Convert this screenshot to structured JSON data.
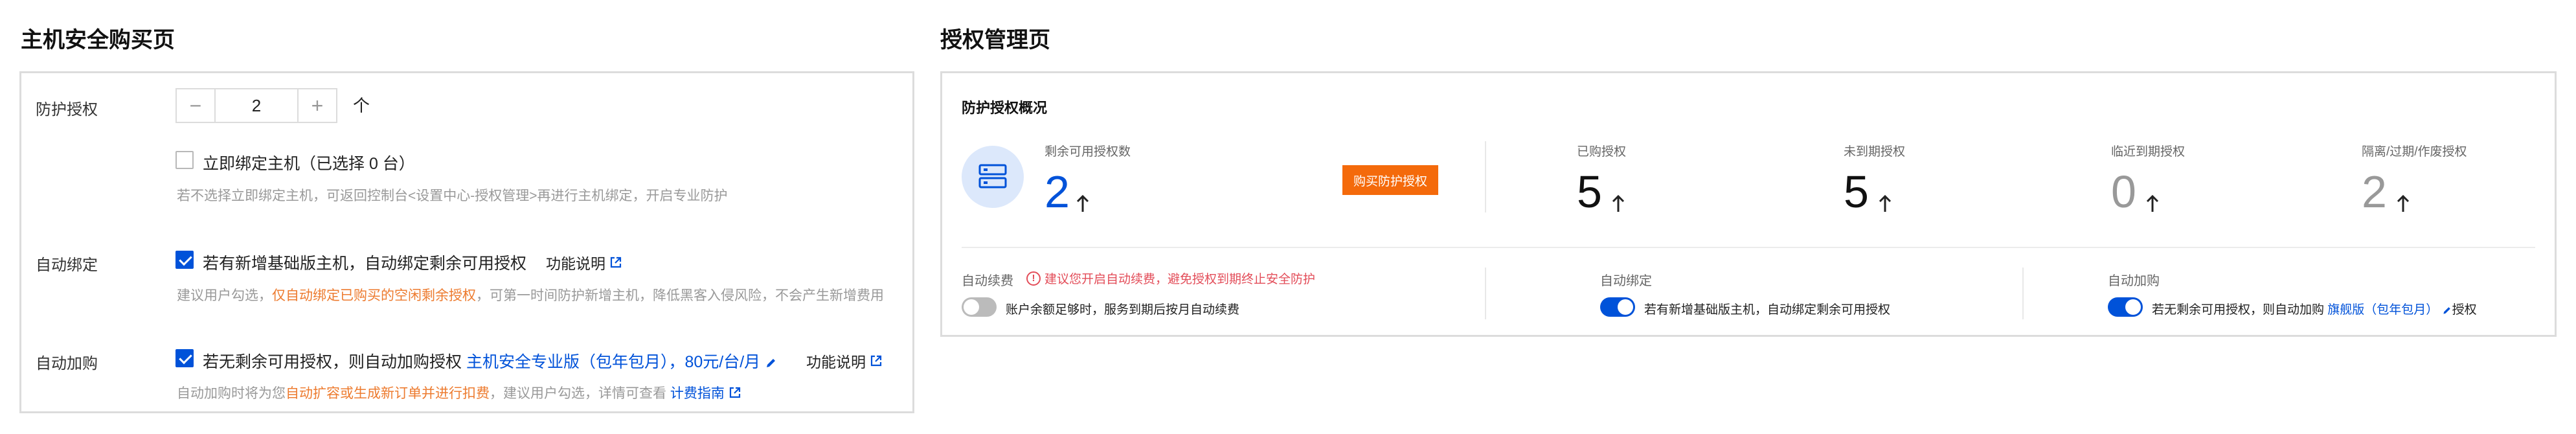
{
  "left": {
    "title": "主机安全购买页",
    "protect_label": "防护授权",
    "stepper": {
      "minus": "−",
      "value": "2",
      "plus": "+"
    },
    "unit": "个",
    "bind_now": {
      "label": "立即绑定主机（已选择 0 台）",
      "hint": "若不选择立即绑定主机，可返回控制台<设置中心-授权管理>再进行主机绑定，开启专业防护"
    },
    "auto_bind": {
      "label": "自动绑定",
      "checkbox_text": "若有新增基础版主机，自动绑定剩余可用授权",
      "func_link": "功能说明",
      "hint_pre": "建议用户勾选，",
      "hint_highlight": "仅自动绑定已购买的空闲剩余授权",
      "hint_post": "，可第一时间防护新增主机，降低黑客入侵风险，不会产生新增费用"
    },
    "auto_buy": {
      "label": "自动加购",
      "checkbox_text_pre": "若无剩余可用授权，则自动加购授权 ",
      "checkbox_text_blue": "主机安全专业版（包年包月），80元/台/月",
      "func_link": "功能说明",
      "hint_pre": "自动加购时将为您",
      "hint_highlight": "自动扩容或生成新订单并进行扣费",
      "hint_post": "，建议用户勾选，详情可查看 ",
      "hint_link": "计费指南"
    }
  },
  "right": {
    "title": "授权管理页",
    "overview_title": "防护授权概况",
    "remaining": {
      "label": "剩余可用授权数",
      "value": "2"
    },
    "buy_button": "购买防护授权",
    "stats": [
      {
        "label": "已购授权",
        "value": "5"
      },
      {
        "label": "未到期授权",
        "value": "5"
      },
      {
        "label": "临近到期授权",
        "value": "0"
      },
      {
        "label": "隔离/过期/作废授权",
        "value": "2"
      }
    ],
    "renew": {
      "label": "自动续费",
      "warning": "建议您开启自动续费，避免授权到期终止安全防护",
      "toggle_text": "账户余额足够时，服务到期后按月自动续费",
      "state": "off"
    },
    "bind": {
      "label": "自动绑定",
      "toggle_text": "若有新增基础版主机，自动绑定剩余可用授权",
      "state": "on"
    },
    "addbuy": {
      "label": "自动加购",
      "toggle_text_pre": "若无剩余可用授权，则自动加购 ",
      "toggle_text_blue": "旗舰版（包年包月）",
      "toggle_text_post": "授权",
      "state": "on"
    },
    "colors": {
      "primary": "#0052d9",
      "orange": "#f46a0b",
      "warn": "#e34d59",
      "muted_number": "#999999"
    }
  }
}
